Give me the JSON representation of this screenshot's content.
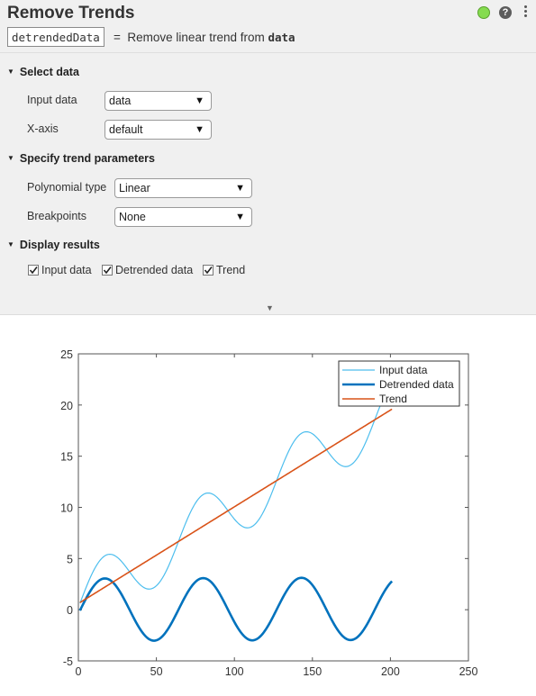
{
  "header": {
    "title": "Remove Trends",
    "status": "ok",
    "status_color": "#85dc4f",
    "help_icon": "?",
    "output_variable": "detrendedData",
    "equals": "=",
    "summary_prefix": "Remove linear trend from",
    "summary_var": "data"
  },
  "sections": {
    "select_data": {
      "title": "Select data",
      "input_data_label": "Input data",
      "input_data_value": "data",
      "xaxis_label": "X-axis",
      "xaxis_value": "default"
    },
    "trend_params": {
      "title": "Specify trend parameters",
      "poly_label": "Polynomial type",
      "poly_value": "Linear",
      "breakpoints_label": "Breakpoints",
      "breakpoints_value": "None"
    },
    "display": {
      "title": "Display results",
      "checkboxes": [
        {
          "label": "Input data",
          "checked": true
        },
        {
          "label": "Detrended data",
          "checked": true
        },
        {
          "label": "Trend",
          "checked": true
        }
      ]
    }
  },
  "chart_data": {
    "type": "line",
    "title": "",
    "xlabel": "",
    "ylabel": "",
    "xlim": [
      0,
      250
    ],
    "ylim": [
      -5,
      25
    ],
    "xticks": [
      0,
      50,
      100,
      150,
      200,
      250
    ],
    "yticks": [
      -5,
      0,
      5,
      10,
      15,
      20,
      25
    ],
    "grid": false,
    "legend_position": "top-right",
    "x_range": [
      1,
      201
    ],
    "series": [
      {
        "name": "Input data",
        "color": "#4dbeee",
        "description": "trend + detrended",
        "samples": {
          "x": [
            1,
            20,
            48,
            80,
            111,
            143,
            174,
            201
          ],
          "y": [
            0.1,
            4.7,
            1.7,
            11.0,
            7.8,
            17.3,
            14.2,
            22.7
          ]
        }
      },
      {
        "name": "Detrended data",
        "color": "#0072bd",
        "description": "sinusoid, amplitude ~3, period ~63",
        "samples": {
          "x": [
            1,
            17,
            48,
            80,
            111,
            143,
            174,
            201
          ],
          "y": [
            -0.6,
            2.5,
            -3.4,
            2.8,
            -3.0,
            3.2,
            -2.7,
            3.2
          ]
        }
      },
      {
        "name": "Trend",
        "color": "#d95319",
        "description": "linear fit",
        "samples": {
          "x": [
            1,
            201
          ],
          "y": [
            0.7,
            19.6
          ]
        }
      }
    ]
  }
}
